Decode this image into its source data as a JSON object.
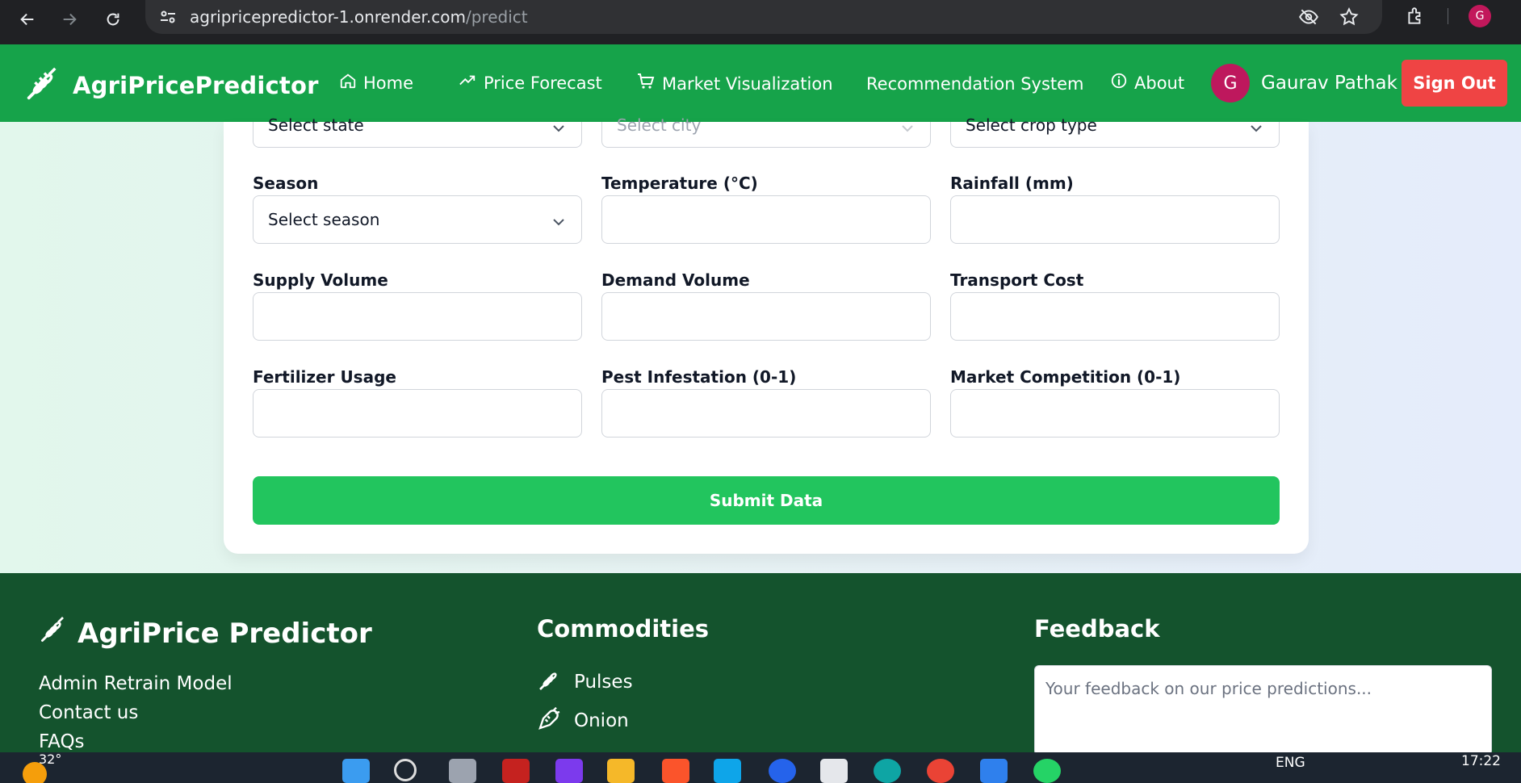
{
  "browser": {
    "url_domain": "agripricepredictor-1.onrender.com",
    "url_path": "/predict",
    "profile_initial": "G",
    "icons": [
      "back-icon",
      "forward-icon",
      "reload-icon",
      "site-settings-icon",
      "eye-off-icon",
      "star-icon",
      "extensions-icon"
    ]
  },
  "header": {
    "brand": "AgriPricePredictor",
    "nav": {
      "home": "Home",
      "forecast": "Price Forecast",
      "market": "Market Visualization",
      "recommend": "Recommendation System",
      "about": "About"
    },
    "user_initial": "G",
    "user_name": "Gaurav Pathak",
    "signout": "Sign Out"
  },
  "form": {
    "row0": {
      "state_placeholder": "Select state",
      "city_placeholder": "Select city",
      "crop_placeholder": "Select crop type"
    },
    "season_label": "Season",
    "season_placeholder": "Select season",
    "temperature_label": "Temperature (°C)",
    "rainfall_label": "Rainfall (mm)",
    "supply_label": "Supply Volume",
    "demand_label": "Demand Volume",
    "transport_label": "Transport Cost",
    "fertilizer_label": "Fertilizer Usage",
    "pest_label": "Pest Infestation (0-1)",
    "competition_label": "Market Competition (0-1)",
    "submit": "Submit Data"
  },
  "footer": {
    "brand": "AgriPrice Predictor",
    "links": [
      "Admin Retrain Model",
      "Contact us",
      "FAQs"
    ],
    "commodities_title": "Commodities",
    "commodities": [
      "Pulses",
      "Onion"
    ],
    "feedback_title": "Feedback",
    "feedback_placeholder": "Your feedback on our price predictions..."
  },
  "taskbar": {
    "temperature": "32°",
    "lang": "ENG",
    "time": "17:22"
  },
  "colors": {
    "header_green": "#16a34a",
    "submit_green": "#22c55e",
    "footer_green": "#14532d",
    "signout_red": "#ef4444",
    "avatar_pink": "#be185d"
  }
}
